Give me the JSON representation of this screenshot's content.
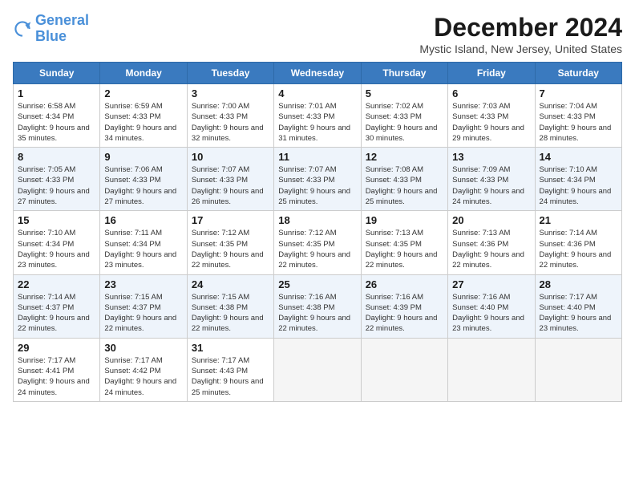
{
  "logo": {
    "line1": "General",
    "line2": "Blue"
  },
  "title": "December 2024",
  "location": "Mystic Island, New Jersey, United States",
  "weekdays": [
    "Sunday",
    "Monday",
    "Tuesday",
    "Wednesday",
    "Thursday",
    "Friday",
    "Saturday"
  ],
  "weeks": [
    [
      {
        "day": "1",
        "sunrise": "6:58 AM",
        "sunset": "4:34 PM",
        "daylight": "9 hours and 35 minutes."
      },
      {
        "day": "2",
        "sunrise": "6:59 AM",
        "sunset": "4:33 PM",
        "daylight": "9 hours and 34 minutes."
      },
      {
        "day": "3",
        "sunrise": "7:00 AM",
        "sunset": "4:33 PM",
        "daylight": "9 hours and 32 minutes."
      },
      {
        "day": "4",
        "sunrise": "7:01 AM",
        "sunset": "4:33 PM",
        "daylight": "9 hours and 31 minutes."
      },
      {
        "day": "5",
        "sunrise": "7:02 AM",
        "sunset": "4:33 PM",
        "daylight": "9 hours and 30 minutes."
      },
      {
        "day": "6",
        "sunrise": "7:03 AM",
        "sunset": "4:33 PM",
        "daylight": "9 hours and 29 minutes."
      },
      {
        "day": "7",
        "sunrise": "7:04 AM",
        "sunset": "4:33 PM",
        "daylight": "9 hours and 28 minutes."
      }
    ],
    [
      {
        "day": "8",
        "sunrise": "7:05 AM",
        "sunset": "4:33 PM",
        "daylight": "9 hours and 27 minutes."
      },
      {
        "day": "9",
        "sunrise": "7:06 AM",
        "sunset": "4:33 PM",
        "daylight": "9 hours and 27 minutes."
      },
      {
        "day": "10",
        "sunrise": "7:07 AM",
        "sunset": "4:33 PM",
        "daylight": "9 hours and 26 minutes."
      },
      {
        "day": "11",
        "sunrise": "7:07 AM",
        "sunset": "4:33 PM",
        "daylight": "9 hours and 25 minutes."
      },
      {
        "day": "12",
        "sunrise": "7:08 AM",
        "sunset": "4:33 PM",
        "daylight": "9 hours and 25 minutes."
      },
      {
        "day": "13",
        "sunrise": "7:09 AM",
        "sunset": "4:33 PM",
        "daylight": "9 hours and 24 minutes."
      },
      {
        "day": "14",
        "sunrise": "7:10 AM",
        "sunset": "4:34 PM",
        "daylight": "9 hours and 24 minutes."
      }
    ],
    [
      {
        "day": "15",
        "sunrise": "7:10 AM",
        "sunset": "4:34 PM",
        "daylight": "9 hours and 23 minutes."
      },
      {
        "day": "16",
        "sunrise": "7:11 AM",
        "sunset": "4:34 PM",
        "daylight": "9 hours and 23 minutes."
      },
      {
        "day": "17",
        "sunrise": "7:12 AM",
        "sunset": "4:35 PM",
        "daylight": "9 hours and 22 minutes."
      },
      {
        "day": "18",
        "sunrise": "7:12 AM",
        "sunset": "4:35 PM",
        "daylight": "9 hours and 22 minutes."
      },
      {
        "day": "19",
        "sunrise": "7:13 AM",
        "sunset": "4:35 PM",
        "daylight": "9 hours and 22 minutes."
      },
      {
        "day": "20",
        "sunrise": "7:13 AM",
        "sunset": "4:36 PM",
        "daylight": "9 hours and 22 minutes."
      },
      {
        "day": "21",
        "sunrise": "7:14 AM",
        "sunset": "4:36 PM",
        "daylight": "9 hours and 22 minutes."
      }
    ],
    [
      {
        "day": "22",
        "sunrise": "7:14 AM",
        "sunset": "4:37 PM",
        "daylight": "9 hours and 22 minutes."
      },
      {
        "day": "23",
        "sunrise": "7:15 AM",
        "sunset": "4:37 PM",
        "daylight": "9 hours and 22 minutes."
      },
      {
        "day": "24",
        "sunrise": "7:15 AM",
        "sunset": "4:38 PM",
        "daylight": "9 hours and 22 minutes."
      },
      {
        "day": "25",
        "sunrise": "7:16 AM",
        "sunset": "4:38 PM",
        "daylight": "9 hours and 22 minutes."
      },
      {
        "day": "26",
        "sunrise": "7:16 AM",
        "sunset": "4:39 PM",
        "daylight": "9 hours and 22 minutes."
      },
      {
        "day": "27",
        "sunrise": "7:16 AM",
        "sunset": "4:40 PM",
        "daylight": "9 hours and 23 minutes."
      },
      {
        "day": "28",
        "sunrise": "7:17 AM",
        "sunset": "4:40 PM",
        "daylight": "9 hours and 23 minutes."
      }
    ],
    [
      {
        "day": "29",
        "sunrise": "7:17 AM",
        "sunset": "4:41 PM",
        "daylight": "9 hours and 24 minutes."
      },
      {
        "day": "30",
        "sunrise": "7:17 AM",
        "sunset": "4:42 PM",
        "daylight": "9 hours and 24 minutes."
      },
      {
        "day": "31",
        "sunrise": "7:17 AM",
        "sunset": "4:43 PM",
        "daylight": "9 hours and 25 minutes."
      },
      null,
      null,
      null,
      null
    ]
  ],
  "labels": {
    "sunrise": "Sunrise:",
    "sunset": "Sunset:",
    "daylight": "Daylight:"
  }
}
